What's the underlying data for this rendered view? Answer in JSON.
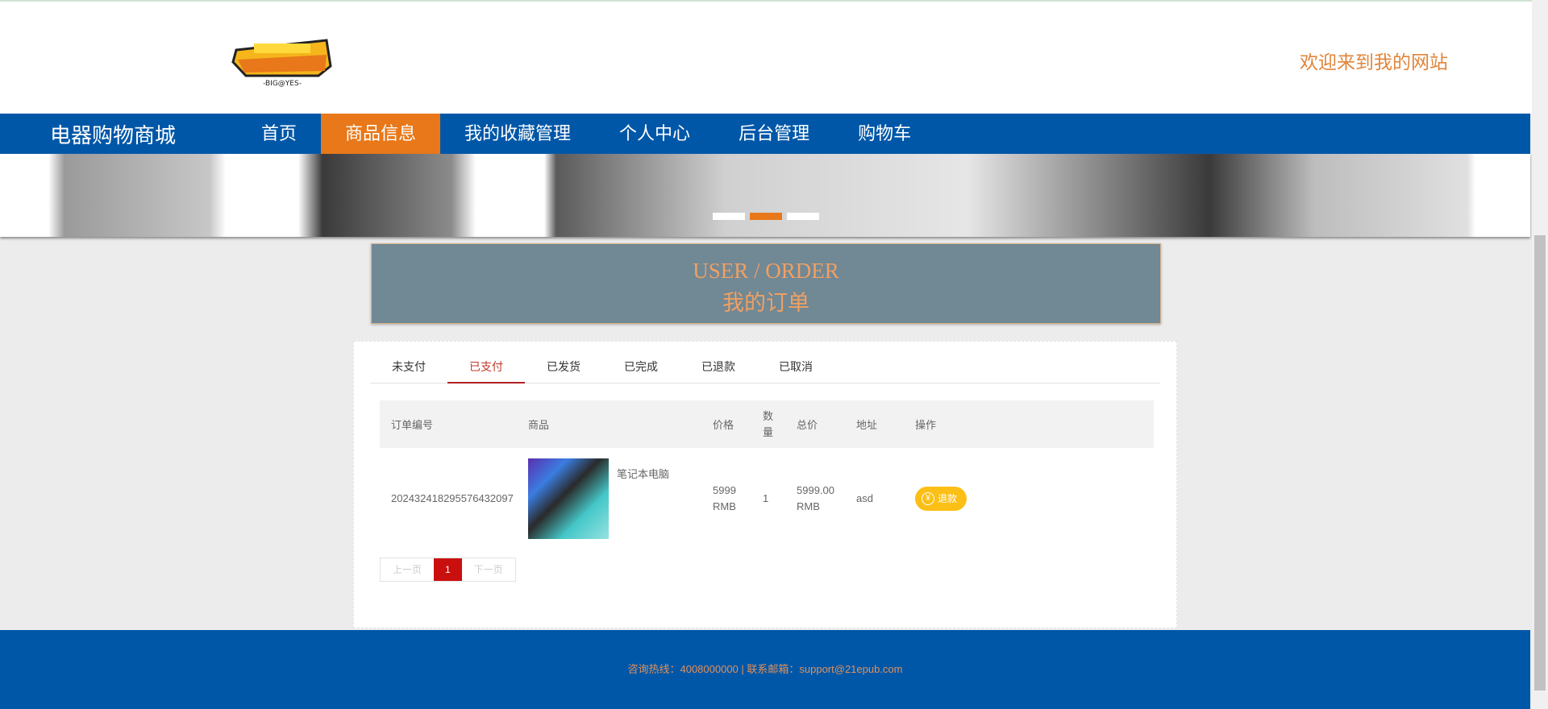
{
  "header": {
    "logo_text": "BIG@YES",
    "welcome": "欢迎来到我的网站"
  },
  "nav": {
    "brand": "电器购物商城",
    "items": [
      {
        "label": "首页"
      },
      {
        "label": "商品信息"
      },
      {
        "label": "我的收藏管理"
      },
      {
        "label": "个人中心"
      },
      {
        "label": "后台管理"
      },
      {
        "label": "购物车"
      }
    ],
    "active_index": 1
  },
  "banner": {
    "slides": 3,
    "active_slide": 2
  },
  "title": {
    "en": "USER / ORDER",
    "zh": "我的订单"
  },
  "tabs": [
    {
      "label": "未支付"
    },
    {
      "label": "已支付"
    },
    {
      "label": "已发货"
    },
    {
      "label": "已完成"
    },
    {
      "label": "已退款"
    },
    {
      "label": "已取消"
    }
  ],
  "table": {
    "headers": [
      "订单编号",
      "商品",
      "价格",
      "数量",
      "总价",
      "地址",
      "操作"
    ],
    "rows": [
      {
        "order_no": "20243241829557643209 7",
        "product": "笔记本电脑",
        "price": "5999 RMB",
        "qty": "1",
        "total": "5999.00 RMB",
        "address": "asd",
        "action": "退款"
      }
    ]
  },
  "pager": {
    "prev": "上一页",
    "current": "1",
    "next": "下一页"
  },
  "footer": {
    "text": "咨询热线：4008000000 | 联系邮箱：support@21epub.com"
  },
  "colors": {
    "nav": "#0057a8",
    "accent": "#e8781a",
    "refund": "#fbbf16",
    "page_active": "#c9100f"
  }
}
